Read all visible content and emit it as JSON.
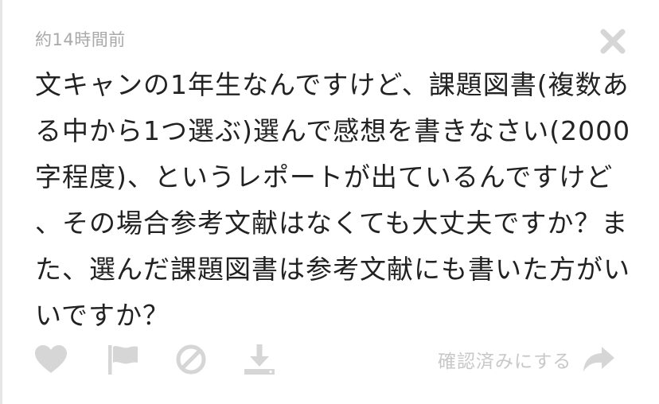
{
  "post": {
    "timestamp": "約14時間前",
    "body": "文キャンの1年生なんですけど、課題図書(複数あ\nる中から1つ選ぶ)選んで感想を書きなさい(2000\n字程度)、というレポートが出ているんですけど\n、その場合参考文献はなくても大丈夫ですか？ま\nた、選んだ課題図書は参考文献にも書いた方がい\nいですか？"
  },
  "actions": {
    "icons": [
      "heart-icon",
      "flag-icon",
      "block-icon",
      "download-icon"
    ],
    "confirm_label": "確認済みにする",
    "reply_icon": "reply-arrow-icon",
    "close_icon": "close-icon"
  },
  "colors": {
    "icon_gray": "#d6d6d6",
    "text": "#222222",
    "muted": "#a9a9a9",
    "label_gray": "#c8c8c8"
  }
}
